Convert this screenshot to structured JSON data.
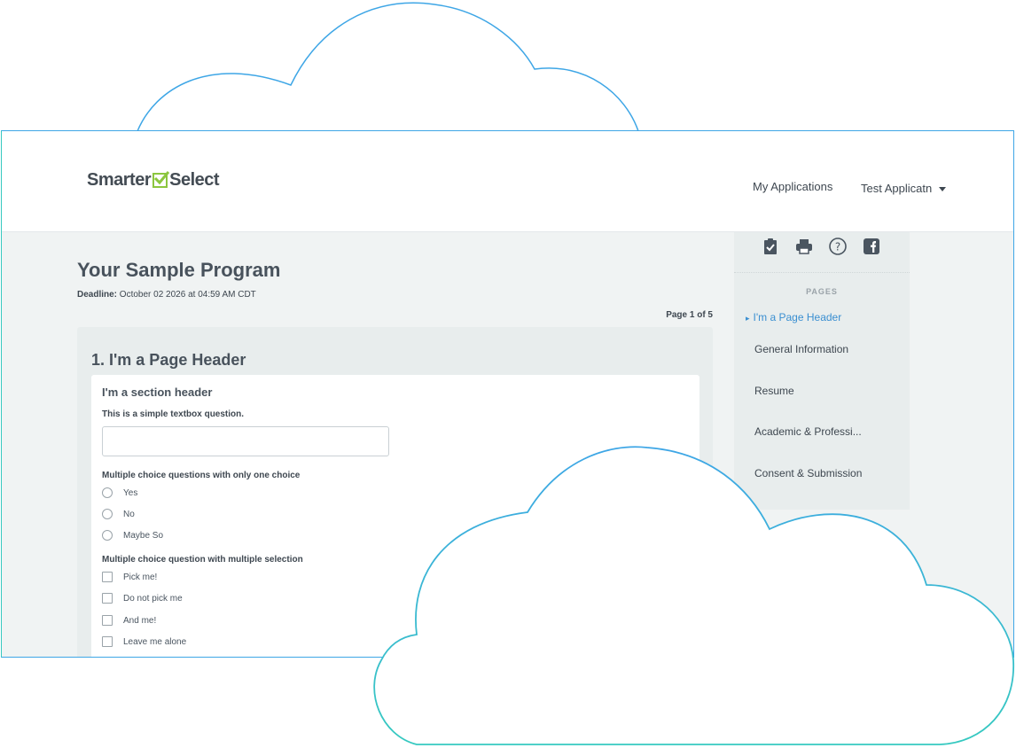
{
  "brand": {
    "name_left": "Smarter",
    "name_right": "Select",
    "accent": "#8cc63f"
  },
  "nav": {
    "my_applications": "My Applications",
    "user_menu": "Test Applicatn"
  },
  "program": {
    "title": "Your Sample Program",
    "deadline_label": "Deadline:",
    "deadline_value": "October 02 2026 at 04:59 AM CDT",
    "page_indicator": "Page 1 of 5"
  },
  "form": {
    "page_header": "1. I'm a Page Header",
    "section_header": "I'm a section header",
    "q1_label": "This is a simple textbox question.",
    "q1_value": "",
    "q2_label": "Multiple choice questions with only one choice",
    "q2_options": [
      "Yes",
      "No",
      "Maybe So"
    ],
    "q3_label": "Multiple choice question with multiple selection",
    "q3_options": [
      "Pick me!",
      "Do not pick me",
      "And me!",
      "Leave me alone"
    ]
  },
  "sidebar": {
    "icons": [
      "clipboard-check-icon",
      "printer-icon",
      "help-circle-icon",
      "facebook-icon"
    ],
    "pages_heading": "PAGES",
    "pages": [
      "I'm a Page Header",
      "General Information",
      "Resume",
      "Academic & Professi...",
      "Consent & Submission"
    ]
  },
  "colors": {
    "cloud_stroke_top": "#3ea6e6",
    "cloud_stroke_bottom": "#36c9c0",
    "link_active": "#3a8fd1"
  }
}
